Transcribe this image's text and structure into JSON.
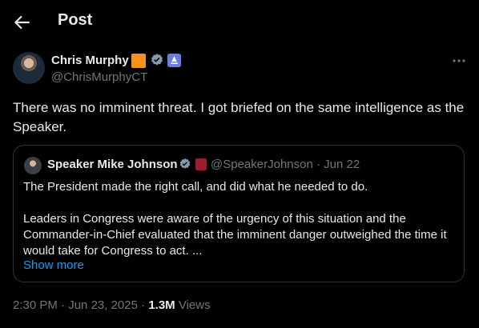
{
  "header": {
    "title": "Post"
  },
  "post": {
    "author_name": "Chris Murphy",
    "author_handle": "@ChrisMurphyCT",
    "text": "There was no imminent threat. I got briefed on the same intelligence as the Speaker.",
    "time": "2:30 PM",
    "date": "Jun 23, 2025",
    "views_count": "1.3M",
    "views_label": "Views"
  },
  "quote": {
    "author_name": "Speaker Mike Johnson",
    "handle_date": "@SpeakerJohnson · Jun 22",
    "paragraph1": "The President made the right call, and did what he needed to do.",
    "paragraph2": "Leaders in Congress were aware of the urgency of this situation and the Commander-in-Chief evaluated that the imminent danger outweighed the time it would take for Congress to act. ...",
    "show_more": "Show more"
  },
  "icons": {
    "back": "arrow-left-icon",
    "more": "more-horizontal-icon",
    "verified": "verified-badge-icon"
  },
  "colors": {
    "background": "#000000",
    "text": "#e7e9ea",
    "muted": "#71767b",
    "link": "#1d9bf0",
    "border": "#2f3336"
  }
}
